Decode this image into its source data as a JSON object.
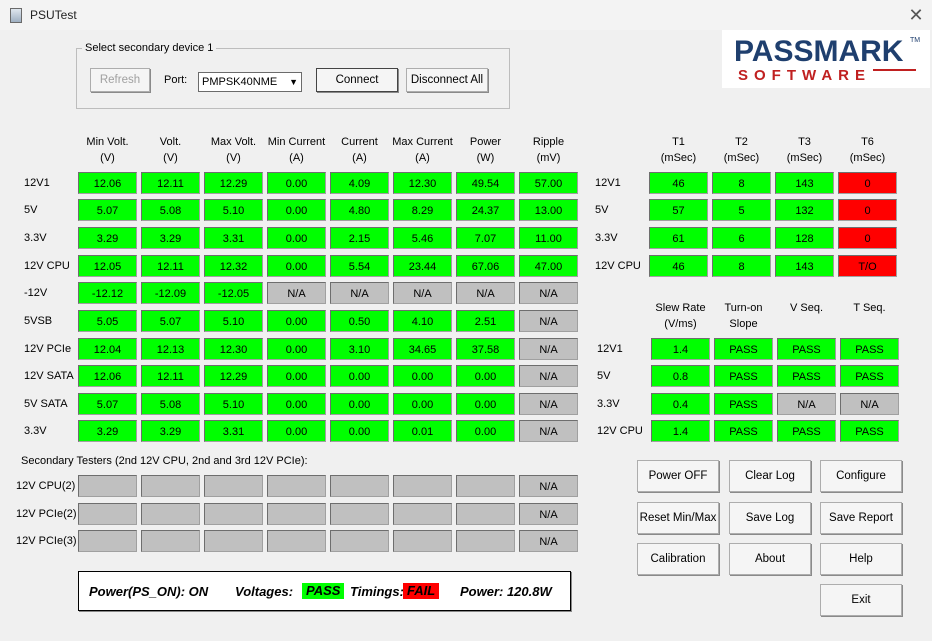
{
  "window": {
    "title": "PSUTest",
    "icon": "app-icon",
    "close_icon": "close-icon"
  },
  "device": {
    "group_title": "Select secondary device 1",
    "refresh_label": "Refresh",
    "port_label": "Port:",
    "port_value": "PMPSK40NME",
    "connect_label": "Connect",
    "disconnect_label": "Disconnect All"
  },
  "logo": {
    "top": "PASSMARK",
    "tm": "TM",
    "bottom": "SOFTWARE"
  },
  "main_table": {
    "headers": [
      {
        "l1": "Min Volt.",
        "l2": "(V)"
      },
      {
        "l1": "Volt.",
        "l2": "(V)"
      },
      {
        "l1": "Max Volt.",
        "l2": "(V)"
      },
      {
        "l1": "Min Current",
        "l2": "(A)"
      },
      {
        "l1": "Current",
        "l2": "(A)"
      },
      {
        "l1": "Max Current",
        "l2": "(A)"
      },
      {
        "l1": "Power",
        "l2": "(W)"
      },
      {
        "l1": "Ripple",
        "l2": "(mV)"
      }
    ],
    "rows": [
      {
        "label": "12V1",
        "values": [
          "12.06",
          "12.11",
          "12.29",
          "0.00",
          "4.09",
          "12.30",
          "49.54",
          "57.00"
        ],
        "states": [
          "g",
          "g",
          "g",
          "g",
          "g",
          "g",
          "g",
          "g"
        ]
      },
      {
        "label": "5V",
        "values": [
          "5.07",
          "5.08",
          "5.10",
          "0.00",
          "4.80",
          "8.29",
          "24.37",
          "13.00"
        ],
        "states": [
          "g",
          "g",
          "g",
          "g",
          "g",
          "g",
          "g",
          "g"
        ]
      },
      {
        "label": "3.3V",
        "values": [
          "3.29",
          "3.29",
          "3.31",
          "0.00",
          "2.15",
          "5.46",
          "7.07",
          "11.00"
        ],
        "states": [
          "g",
          "g",
          "g",
          "g",
          "g",
          "g",
          "g",
          "g"
        ]
      },
      {
        "label": "12V CPU",
        "values": [
          "12.05",
          "12.11",
          "12.32",
          "0.00",
          "5.54",
          "23.44",
          "67.06",
          "47.00"
        ],
        "states": [
          "g",
          "g",
          "g",
          "g",
          "g",
          "g",
          "g",
          "g"
        ]
      },
      {
        "label": "-12V",
        "values": [
          "-12.12",
          "-12.09",
          "-12.05",
          "N/A",
          "N/A",
          "N/A",
          "N/A",
          "N/A"
        ],
        "states": [
          "g",
          "g",
          "g",
          "x",
          "x",
          "x",
          "x",
          "x"
        ]
      },
      {
        "label": "5VSB",
        "values": [
          "5.05",
          "5.07",
          "5.10",
          "0.00",
          "0.50",
          "4.10",
          "2.51",
          "N/A"
        ],
        "states": [
          "g",
          "g",
          "g",
          "g",
          "g",
          "g",
          "g",
          "x"
        ]
      },
      {
        "label": "12V PCIe",
        "values": [
          "12.04",
          "12.13",
          "12.30",
          "0.00",
          "3.10",
          "34.65",
          "37.58",
          "N/A"
        ],
        "states": [
          "g",
          "g",
          "g",
          "g",
          "g",
          "g",
          "g",
          "x"
        ]
      },
      {
        "label": "12V SATA",
        "values": [
          "12.06",
          "12.11",
          "12.29",
          "0.00",
          "0.00",
          "0.00",
          "0.00",
          "N/A"
        ],
        "states": [
          "g",
          "g",
          "g",
          "g",
          "g",
          "g",
          "g",
          "x"
        ]
      },
      {
        "label": "5V SATA",
        "values": [
          "5.07",
          "5.08",
          "5.10",
          "0.00",
          "0.00",
          "0.00",
          "0.00",
          "N/A"
        ],
        "states": [
          "g",
          "g",
          "g",
          "g",
          "g",
          "g",
          "g",
          "x"
        ]
      },
      {
        "label": "3.3V",
        "values": [
          "3.29",
          "3.29",
          "3.31",
          "0.00",
          "0.00",
          "0.01",
          "0.00",
          "N/A"
        ],
        "states": [
          "g",
          "g",
          "g",
          "g",
          "g",
          "g",
          "g",
          "x"
        ]
      }
    ]
  },
  "secondary": {
    "title": "Secondary Testers (2nd 12V CPU, 2nd and 3rd 12V PCIe):",
    "rows": [
      {
        "label": "12V CPU(2)",
        "values": [
          "",
          "",
          "",
          "",
          "",
          "",
          "",
          "N/A"
        ]
      },
      {
        "label": "12V PCIe(2)",
        "values": [
          "",
          "",
          "",
          "",
          "",
          "",
          "",
          "N/A"
        ]
      },
      {
        "label": "12V PCIe(3)",
        "values": [
          "",
          "",
          "",
          "",
          "",
          "",
          "",
          "N/A"
        ]
      }
    ]
  },
  "timing_table": {
    "headers": [
      {
        "l1": "T1",
        "l2": "(mSec)"
      },
      {
        "l1": "T2",
        "l2": "(mSec)"
      },
      {
        "l1": "T3",
        "l2": "(mSec)"
      },
      {
        "l1": "T6",
        "l2": "(mSec)"
      }
    ],
    "rows": [
      {
        "label": "12V1",
        "values": [
          "46",
          "8",
          "143",
          "0"
        ],
        "states": [
          "g",
          "g",
          "g",
          "r"
        ]
      },
      {
        "label": "5V",
        "values": [
          "57",
          "5",
          "132",
          "0"
        ],
        "states": [
          "g",
          "g",
          "g",
          "r"
        ]
      },
      {
        "label": "3.3V",
        "values": [
          "61",
          "6",
          "128",
          "0"
        ],
        "states": [
          "g",
          "g",
          "g",
          "r"
        ]
      },
      {
        "label": "12V CPU",
        "values": [
          "46",
          "8",
          "143",
          "T/O"
        ],
        "states": [
          "g",
          "g",
          "g",
          "r"
        ]
      }
    ]
  },
  "slew_table": {
    "headers": [
      {
        "l1": "Slew Rate",
        "l2": "(V/ms)"
      },
      {
        "l1": "Turn-on",
        "l2": "Slope"
      },
      {
        "l1": "V Seq.",
        "l2": ""
      },
      {
        "l1": "T Seq.",
        "l2": ""
      }
    ],
    "rows": [
      {
        "label": "12V1",
        "values": [
          "1.4",
          "PASS",
          "PASS",
          "PASS"
        ],
        "states": [
          "g",
          "g",
          "g",
          "g"
        ]
      },
      {
        "label": "5V",
        "values": [
          "0.8",
          "PASS",
          "PASS",
          "PASS"
        ],
        "states": [
          "g",
          "g",
          "g",
          "g"
        ]
      },
      {
        "label": "3.3V",
        "values": [
          "0.4",
          "PASS",
          "N/A",
          "N/A"
        ],
        "states": [
          "g",
          "g",
          "x",
          "x"
        ]
      },
      {
        "label": "12V CPU",
        "values": [
          "1.4",
          "PASS",
          "PASS",
          "PASS"
        ],
        "states": [
          "g",
          "g",
          "g",
          "g"
        ]
      }
    ]
  },
  "buttons": {
    "power_off": "Power OFF",
    "clear_log": "Clear Log",
    "configure": "Configure",
    "reset_minmax": "Reset Min/Max",
    "save_log": "Save Log",
    "save_report": "Save Report",
    "calibration": "Calibration",
    "about": "About",
    "help": "Help",
    "exit": "Exit"
  },
  "status": {
    "power_label": "Power(PS_ON): ON",
    "voltages_label": "Voltages:",
    "voltages_value": "PASS",
    "timings_label": "Timings:",
    "timings_value": "FAIL",
    "power_total": "Power: 120.8W"
  },
  "colors": {
    "pass": "#00ff00",
    "fail": "#ff0000",
    "na": "#c0c0c0"
  }
}
